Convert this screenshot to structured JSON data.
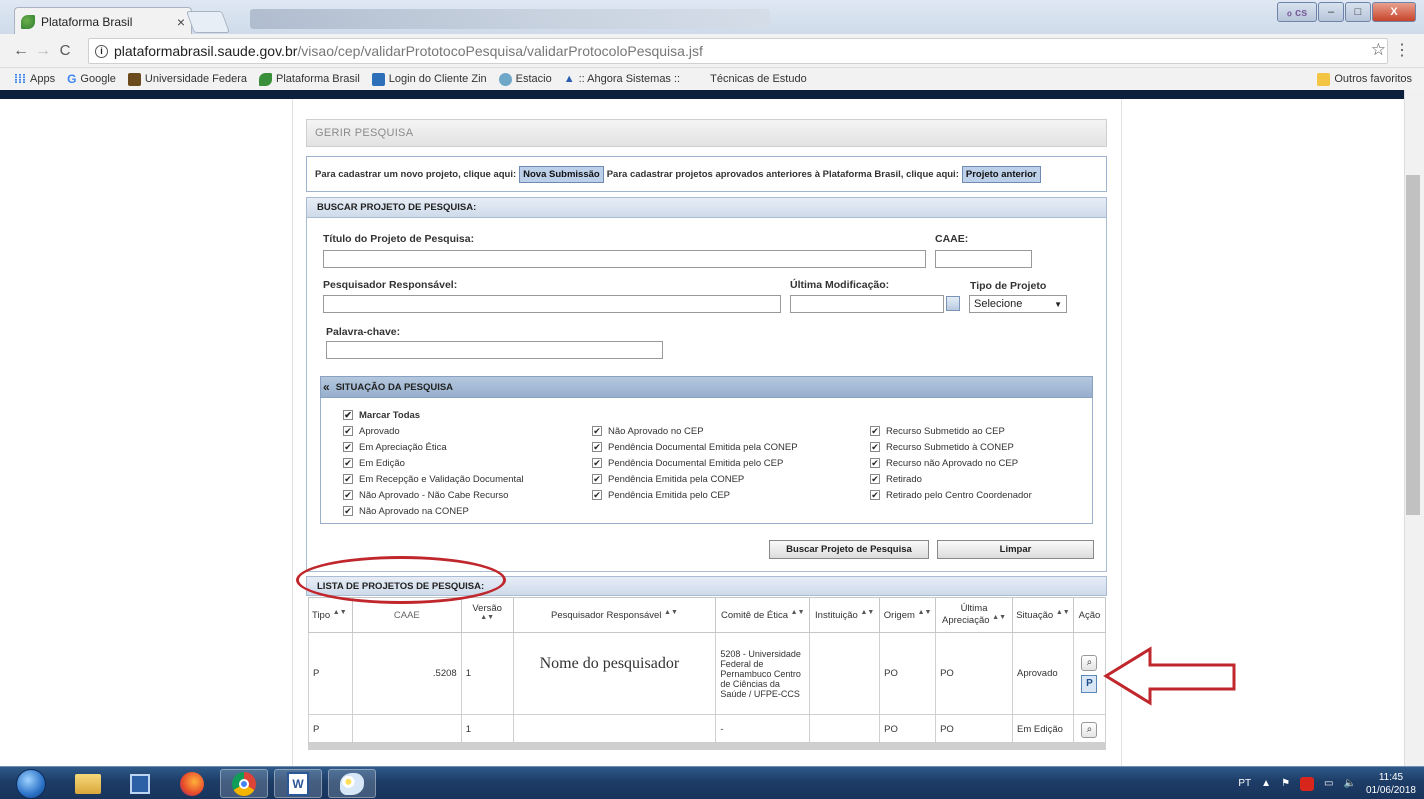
{
  "browser": {
    "tab_title": "Plataforma Brasil",
    "tab_close": "×",
    "url_host": "plataformabrasil.saude.gov.br",
    "url_path": "/visao/cep/validarPrototocoPesquisa/validarProtocoloPesquisa.jsf",
    "bookmarks": [
      {
        "label": "Apps"
      },
      {
        "label": "Google"
      },
      {
        "label": "Universidade Federa"
      },
      {
        "label": "Plataforma Brasil"
      },
      {
        "label": "Login do Cliente Zin"
      },
      {
        "label": "Estacio"
      },
      {
        "label": ":: Ahgora Sistemas ::"
      },
      {
        "label": "Técnicas de Estudo"
      }
    ],
    "other_bookmarks": "Outros favoritos",
    "window_ext_label": "ℴ cs",
    "window_min": "–",
    "window_max": "□",
    "window_close": "X"
  },
  "page": {
    "section_title": "GERIR PESQUISA",
    "new_project_text": "Para cadastrar um novo projeto, clique aqui:",
    "new_submission_btn": "Nova Submissão",
    "previous_project_text": "Para cadastrar projetos aprovados anteriores à Plataforma Brasil, clique aqui:",
    "previous_project_btn": "Projeto anterior",
    "search": {
      "header": "BUSCAR PROJETO DE PESQUISA:",
      "title_label": "Título do Projeto de Pesquisa:",
      "caae_label": "CAAE:",
      "researcher_label": "Pesquisador Responsável:",
      "last_mod_label": "Última Modificação:",
      "project_type_label": "Tipo de Projeto",
      "project_type_value": "Selecione",
      "keyword_label": "Palavra-chave:",
      "situation_header": "SITUAÇÃO DA PESQUISA",
      "collapse_glyph": "«",
      "mark_all": "Marcar Todas",
      "status_col1": [
        "Aprovado",
        "Em Apreciação Ética",
        "Em Edição",
        "Em Recepção e Validação Documental",
        "Não Aprovado - Não Cabe Recurso",
        "Não Aprovado na CONEP"
      ],
      "status_col2": [
        "Não Aprovado no CEP",
        "Pendência Documental Emitida pela CONEP",
        "Pendência Documental Emitida pelo CEP",
        "Pendência Emitida pela CONEP",
        "Pendência Emitida pelo CEP"
      ],
      "status_col3": [
        "Recurso Submetido ao CEP",
        "Recurso Submetido à CONEP",
        "Recurso não Aprovado no CEP",
        "Retirado",
        "Retirado pelo Centro Coordenador"
      ],
      "search_btn": "Buscar Projeto de Pesquisa",
      "clear_btn": "Limpar"
    },
    "list": {
      "header": "LISTA DE PROJETOS DE PESQUISA:",
      "columns": [
        "Tipo",
        "CAAE",
        "Versão",
        "Pesquisador Responsável",
        "Comitê de Ética",
        "Instituição",
        "Origem",
        "Última Apreciação",
        "Situação",
        "Ação"
      ],
      "rows": [
        {
          "tipo": "P",
          "caae": ".5208",
          "versao": "1",
          "pesquisador": "Nome do pesquisador",
          "comite": "5208 - Universidade Federal de Pernambuco Centro de Ciências da Saúde / UFPE-CCS",
          "instituicao": "",
          "origem": "PO",
          "ultima": "PO",
          "situacao": "Aprovado"
        },
        {
          "tipo": "P",
          "caae": "",
          "versao": "1",
          "pesquisador": "",
          "comite": "-",
          "instituicao": "",
          "origem": "PO",
          "ultima": "PO",
          "situacao": "Em Edição"
        }
      ]
    }
  },
  "taskbar": {
    "lang": "PT",
    "time": "11:45",
    "date": "01/06/2018"
  },
  "colors": {
    "accent_red": "#c0272d",
    "section_blue": "#cfdbea",
    "taskbar": "#1d3c66"
  }
}
